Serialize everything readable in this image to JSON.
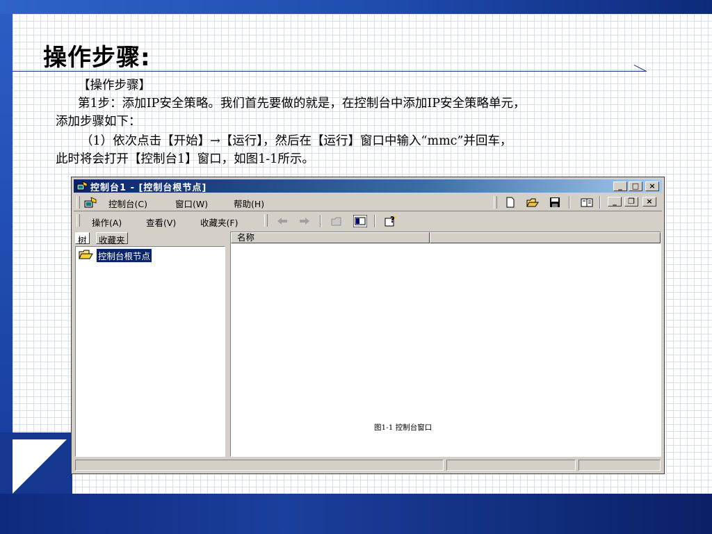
{
  "slide": {
    "title": "操作步骤:",
    "paragraphs": [
      "【操作步骤】",
      "第1步：添加IP安全策略。我们首先要做的就是，在控制台中添加IP安全策略单元，",
      "添加步骤如下：",
      "（1）依次点击【开始】→【运行】，然后在【运行】窗口中输入“mmc”并回车，",
      "此时将会打开【控制台1】窗口，如图1-1所示。"
    ]
  },
  "window": {
    "title": "控制台1 - [控制台根节点]",
    "title_buttons": {
      "minimize": "_",
      "maximize": "□",
      "close": "×"
    },
    "menu": {
      "console": "控制台(C)",
      "window": "窗口(W)",
      "help": "帮助(H)"
    },
    "mdi_buttons": {
      "minimize": "_",
      "restore": "❐",
      "close": "×"
    },
    "action_menu": {
      "action": "操作(A)",
      "view": "查看(V)",
      "favorites": "收藏夹(F)"
    },
    "tabs": {
      "tree": "树",
      "favorites": "收藏夹"
    },
    "tree_root": "控制台根节点",
    "list_column": "名称",
    "figure_caption": "图1-1 控制台窗口"
  },
  "colors": {
    "title_bar": "#0a246a",
    "window_face": "#d4d0c8",
    "slide_accent": "#16378f"
  }
}
